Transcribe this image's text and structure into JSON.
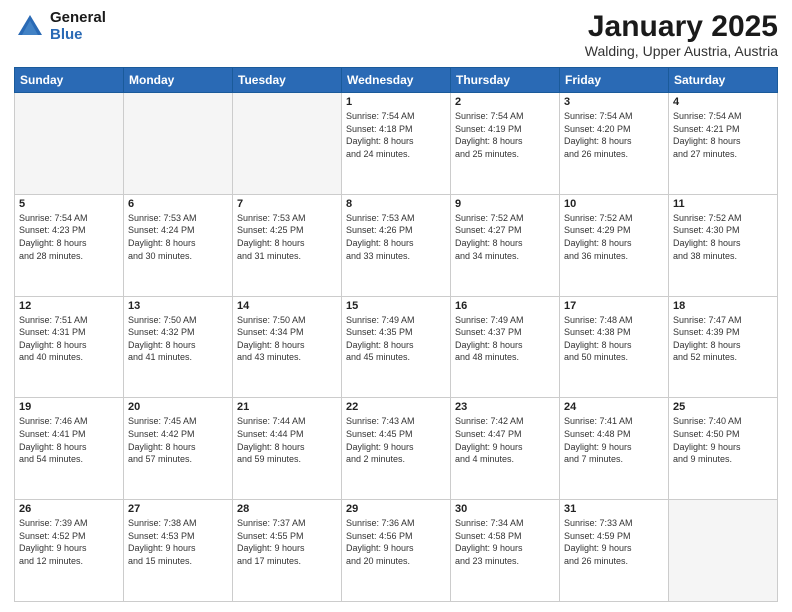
{
  "logo": {
    "general": "General",
    "blue": "Blue"
  },
  "header": {
    "month": "January 2025",
    "location": "Walding, Upper Austria, Austria"
  },
  "days_of_week": [
    "Sunday",
    "Monday",
    "Tuesday",
    "Wednesday",
    "Thursday",
    "Friday",
    "Saturday"
  ],
  "weeks": [
    [
      {
        "day": "",
        "info": ""
      },
      {
        "day": "",
        "info": ""
      },
      {
        "day": "",
        "info": ""
      },
      {
        "day": "1",
        "info": "Sunrise: 7:54 AM\nSunset: 4:18 PM\nDaylight: 8 hours\nand 24 minutes."
      },
      {
        "day": "2",
        "info": "Sunrise: 7:54 AM\nSunset: 4:19 PM\nDaylight: 8 hours\nand 25 minutes."
      },
      {
        "day": "3",
        "info": "Sunrise: 7:54 AM\nSunset: 4:20 PM\nDaylight: 8 hours\nand 26 minutes."
      },
      {
        "day": "4",
        "info": "Sunrise: 7:54 AM\nSunset: 4:21 PM\nDaylight: 8 hours\nand 27 minutes."
      }
    ],
    [
      {
        "day": "5",
        "info": "Sunrise: 7:54 AM\nSunset: 4:23 PM\nDaylight: 8 hours\nand 28 minutes."
      },
      {
        "day": "6",
        "info": "Sunrise: 7:53 AM\nSunset: 4:24 PM\nDaylight: 8 hours\nand 30 minutes."
      },
      {
        "day": "7",
        "info": "Sunrise: 7:53 AM\nSunset: 4:25 PM\nDaylight: 8 hours\nand 31 minutes."
      },
      {
        "day": "8",
        "info": "Sunrise: 7:53 AM\nSunset: 4:26 PM\nDaylight: 8 hours\nand 33 minutes."
      },
      {
        "day": "9",
        "info": "Sunrise: 7:52 AM\nSunset: 4:27 PM\nDaylight: 8 hours\nand 34 minutes."
      },
      {
        "day": "10",
        "info": "Sunrise: 7:52 AM\nSunset: 4:29 PM\nDaylight: 8 hours\nand 36 minutes."
      },
      {
        "day": "11",
        "info": "Sunrise: 7:52 AM\nSunset: 4:30 PM\nDaylight: 8 hours\nand 38 minutes."
      }
    ],
    [
      {
        "day": "12",
        "info": "Sunrise: 7:51 AM\nSunset: 4:31 PM\nDaylight: 8 hours\nand 40 minutes."
      },
      {
        "day": "13",
        "info": "Sunrise: 7:50 AM\nSunset: 4:32 PM\nDaylight: 8 hours\nand 41 minutes."
      },
      {
        "day": "14",
        "info": "Sunrise: 7:50 AM\nSunset: 4:34 PM\nDaylight: 8 hours\nand 43 minutes."
      },
      {
        "day": "15",
        "info": "Sunrise: 7:49 AM\nSunset: 4:35 PM\nDaylight: 8 hours\nand 45 minutes."
      },
      {
        "day": "16",
        "info": "Sunrise: 7:49 AM\nSunset: 4:37 PM\nDaylight: 8 hours\nand 48 minutes."
      },
      {
        "day": "17",
        "info": "Sunrise: 7:48 AM\nSunset: 4:38 PM\nDaylight: 8 hours\nand 50 minutes."
      },
      {
        "day": "18",
        "info": "Sunrise: 7:47 AM\nSunset: 4:39 PM\nDaylight: 8 hours\nand 52 minutes."
      }
    ],
    [
      {
        "day": "19",
        "info": "Sunrise: 7:46 AM\nSunset: 4:41 PM\nDaylight: 8 hours\nand 54 minutes."
      },
      {
        "day": "20",
        "info": "Sunrise: 7:45 AM\nSunset: 4:42 PM\nDaylight: 8 hours\nand 57 minutes."
      },
      {
        "day": "21",
        "info": "Sunrise: 7:44 AM\nSunset: 4:44 PM\nDaylight: 8 hours\nand 59 minutes."
      },
      {
        "day": "22",
        "info": "Sunrise: 7:43 AM\nSunset: 4:45 PM\nDaylight: 9 hours\nand 2 minutes."
      },
      {
        "day": "23",
        "info": "Sunrise: 7:42 AM\nSunset: 4:47 PM\nDaylight: 9 hours\nand 4 minutes."
      },
      {
        "day": "24",
        "info": "Sunrise: 7:41 AM\nSunset: 4:48 PM\nDaylight: 9 hours\nand 7 minutes."
      },
      {
        "day": "25",
        "info": "Sunrise: 7:40 AM\nSunset: 4:50 PM\nDaylight: 9 hours\nand 9 minutes."
      }
    ],
    [
      {
        "day": "26",
        "info": "Sunrise: 7:39 AM\nSunset: 4:52 PM\nDaylight: 9 hours\nand 12 minutes."
      },
      {
        "day": "27",
        "info": "Sunrise: 7:38 AM\nSunset: 4:53 PM\nDaylight: 9 hours\nand 15 minutes."
      },
      {
        "day": "28",
        "info": "Sunrise: 7:37 AM\nSunset: 4:55 PM\nDaylight: 9 hours\nand 17 minutes."
      },
      {
        "day": "29",
        "info": "Sunrise: 7:36 AM\nSunset: 4:56 PM\nDaylight: 9 hours\nand 20 minutes."
      },
      {
        "day": "30",
        "info": "Sunrise: 7:34 AM\nSunset: 4:58 PM\nDaylight: 9 hours\nand 23 minutes."
      },
      {
        "day": "31",
        "info": "Sunrise: 7:33 AM\nSunset: 4:59 PM\nDaylight: 9 hours\nand 26 minutes."
      },
      {
        "day": "",
        "info": ""
      }
    ]
  ]
}
